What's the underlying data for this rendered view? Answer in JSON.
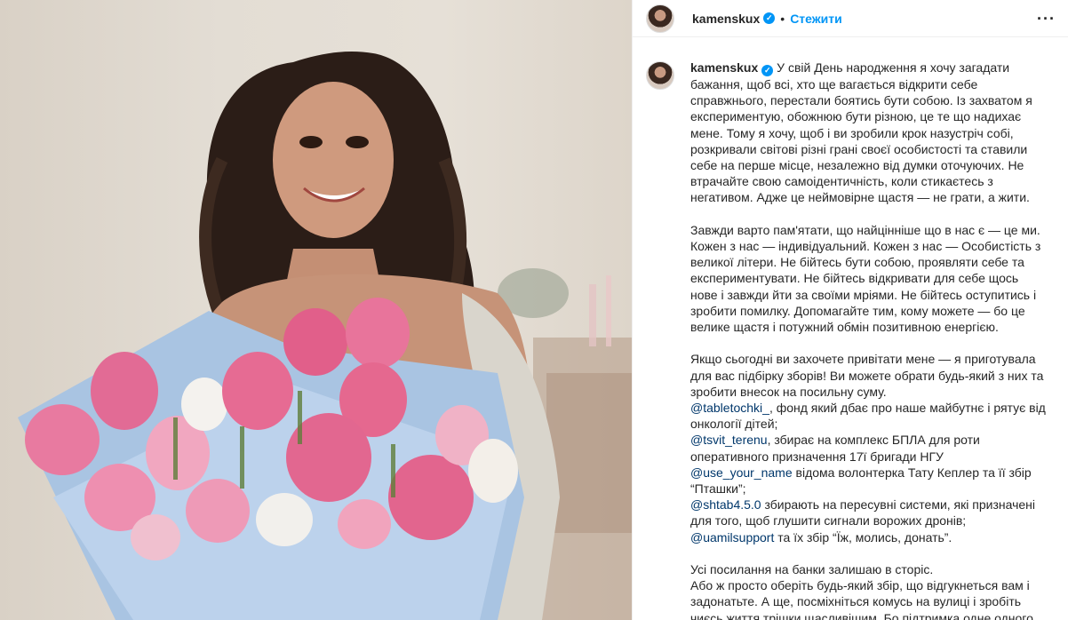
{
  "header": {
    "username": "kamenskux",
    "dot": "•",
    "follow_label": "Стежити",
    "more_icon": "more-horizontal-icon"
  },
  "caption": {
    "username": "kamenskux",
    "p1": "У свій День народження я хочу загадати бажання, щоб всі, хто ще вагається відкрити себе справжнього, перестали боятись бути собою. Із захватом я експериментую, обожнюю бути різною, це те що надихає мене. Тому я хочу, щоб і ви зробили крок назустріч собі, розкривали світові різні грані своєї особистості та ставили себе на перше місце, незалежно від думки оточуючих. Не втрачайте свою самоідентичність, коли стикаєтесь з негативом. Адже це неймовірне щастя — не грати, а жити.",
    "p2": "Завжди варто пам'ятати, що найцінніше що в нас є — це ми. Кожен з нас — індивідуальний. Кожен з нас — Особистість з великої літери. Не бійтесь бути собою, проявляти себе та експериментувати. Не бійтесь відкривати для себе щось нове і завжди йти за своїми мріями. Не бійтесь оступитись і зробити помилку. Допомагайте тим, кому можете — бо це велике щастя і потужний обмін позитивною енергією.",
    "p3": "Якщо сьогодні ви захочете привітати мене — я приготувала для вас підбірку зборів! Ви можете обрати будь-який з них та зробити внесок на посильну суму.",
    "links": [
      {
        "mention": "@tabletochki_",
        "text": ", фонд який дбає про наше майбутнє і рятує від онкології дітей;"
      },
      {
        "mention": "@tsvit_terenu",
        "text": ", збирає на комплекс БПЛА для роти оперативного призначення 17ї бригади НГУ"
      },
      {
        "mention": "@use_your_name",
        "text": " відома волонтерка Тату Кеплер та її збір “Пташки”;"
      },
      {
        "mention": "@shtab4.5.0",
        "text": " збирають на пересувні системи, які призначені для того, щоб глушити сигнали ворожих дронів;"
      },
      {
        "mention": "@uamilsupport",
        "text": " та їх збір “Їж, молись, донать”."
      }
    ],
    "p4": "Усі посилання на банки залишаю в сторіс.",
    "p5": "Або ж просто оберіть будь-який збір, що відгукнеться вам і задонатьте. А ще, посміхніться комусь на вулиці і зробіть чиєсь життя трішки щасливішим. Бо підтримка одне одного"
  },
  "colors": {
    "accent": "#0095f6",
    "mention": "#00376b",
    "text": "#262626"
  },
  "icons": [
    "verified-badge-icon",
    "more-horizontal-icon"
  ]
}
